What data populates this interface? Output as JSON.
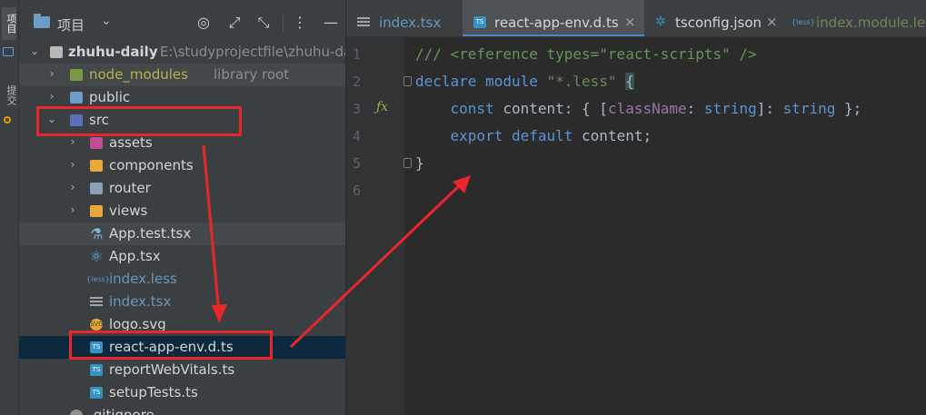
{
  "left_strip": {
    "project_tab": "项目",
    "commit_tab": "提交"
  },
  "project_panel": {
    "title": "项目",
    "tree": [
      {
        "name": "zhuhu-daily",
        "extra": "E:\\studyprojectfile\\zhuhu-da",
        "icon": "folder-icon",
        "expanded": true,
        "depth": 0
      },
      {
        "name": "node_modules",
        "extra": "library root",
        "icon": "folder-icon",
        "depth": 1
      },
      {
        "name": "public",
        "extra": "",
        "icon": "web-folder-icon",
        "depth": 1
      },
      {
        "name": "src",
        "extra": "",
        "icon": "source-folder-icon",
        "expanded": true,
        "depth": 1
      },
      {
        "name": "assets",
        "icon": "folder-icon",
        "depth": 2
      },
      {
        "name": "components",
        "icon": "folder-icon",
        "depth": 2
      },
      {
        "name": "router",
        "icon": "folder-icon",
        "depth": 2
      },
      {
        "name": "views",
        "icon": "folder-icon",
        "depth": 2
      },
      {
        "name": "App.test.tsx",
        "icon": "test-icon",
        "depth": 2
      },
      {
        "name": "App.tsx",
        "icon": "react-icon",
        "depth": 2
      },
      {
        "name": "index.less",
        "icon": "less-icon",
        "depth": 2
      },
      {
        "name": "index.tsx",
        "icon": "tsx-icon",
        "depth": 2
      },
      {
        "name": "logo.svg",
        "icon": "svg-icon",
        "depth": 2
      },
      {
        "name": "react-app-env.d.ts",
        "icon": "ts-icon",
        "depth": 2
      },
      {
        "name": "reportWebVitals.ts",
        "icon": "ts-icon",
        "depth": 2
      },
      {
        "name": "setupTests.ts",
        "icon": "ts-icon",
        "depth": 2
      },
      {
        "name": ".gitignore",
        "icon": "gitignore-icon",
        "depth": 1
      }
    ]
  },
  "editor": {
    "tabs": [
      {
        "label": "index.tsx",
        "icon": "tsx-icon"
      },
      {
        "label": "react-app-env.d.ts",
        "icon": "ts-icon",
        "active": true
      },
      {
        "label": "tsconfig.json",
        "icon": "json-icon"
      },
      {
        "label": "index.module.les",
        "icon": "less-icon"
      }
    ],
    "line_numbers": [
      "1",
      "2",
      "3",
      "4",
      "5",
      "6"
    ],
    "code": {
      "l1": "/// <reference types=\"react-scripts\" />",
      "l2_kw": "declare",
      "l2_mod": "module",
      "l2_str": "\"*.less\"",
      "l2_brace": "{",
      "l3_const": "const",
      "l3_rest1": " content: { [",
      "l3_prop": "className",
      "l3_rest2": ": ",
      "l3_type1": "string",
      "l3_rest3": "]: ",
      "l3_type2": "string",
      "l3_rest4": " };",
      "l4_export": "export",
      "l4_default": "default",
      "l4_rest": " content;",
      "l5": "}"
    }
  },
  "colors": {
    "annotation_red": "#e8262b",
    "selection": "#0d293e"
  }
}
